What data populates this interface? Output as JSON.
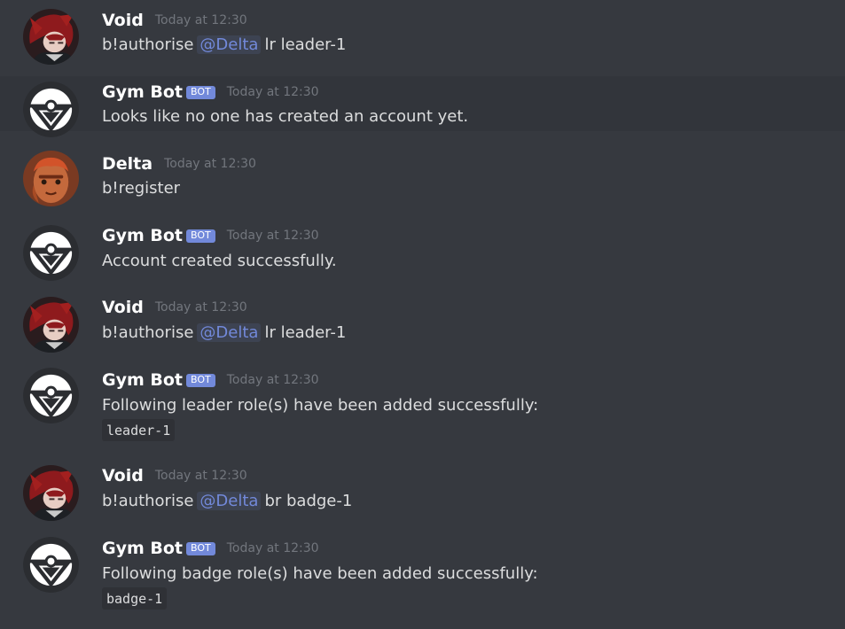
{
  "colors": {
    "background": "#36393f",
    "highlight_row": "#32353b",
    "username": "#ffffff",
    "message_text": "#dcddde",
    "timestamp": "#72767d",
    "mention": "#7289da",
    "bot_badge": "#7289da",
    "code_background": "#2f3136"
  },
  "messages": [
    {
      "author": "Void",
      "is_bot": false,
      "avatar": "void-avatar",
      "timestamp": "Today at 12:30",
      "text_before": "b!authorise",
      "mention": "@Delta",
      "text_after": "lr leader-1"
    },
    {
      "author": "Gym Bot",
      "is_bot": true,
      "badge": "BOT",
      "avatar": "gym-bot-avatar",
      "timestamp": "Today at 12:30",
      "text": "Looks like no one has created an account yet."
    },
    {
      "author": "Delta",
      "is_bot": false,
      "avatar": "delta-avatar",
      "timestamp": "Today at 12:30",
      "text": "b!register"
    },
    {
      "author": "Gym Bot",
      "is_bot": true,
      "badge": "BOT",
      "avatar": "gym-bot-avatar",
      "timestamp": "Today at 12:30",
      "text": "Account created successfully."
    },
    {
      "author": "Void",
      "is_bot": false,
      "avatar": "void-avatar",
      "timestamp": "Today at 12:30",
      "text_before": "b!authorise",
      "mention": "@Delta",
      "text_after": "lr leader-1"
    },
    {
      "author": "Gym Bot",
      "is_bot": true,
      "badge": "BOT",
      "avatar": "gym-bot-avatar",
      "timestamp": "Today at 12:30",
      "text": "Following leader role(s) have been added successfully:",
      "code": "leader-1"
    },
    {
      "author": "Void",
      "is_bot": false,
      "avatar": "void-avatar",
      "timestamp": "Today at 12:30",
      "text_before": "b!authorise",
      "mention": "@Delta",
      "text_after": "br badge-1"
    },
    {
      "author": "Gym Bot",
      "is_bot": true,
      "badge": "BOT",
      "avatar": "gym-bot-avatar",
      "timestamp": "Today at 12:30",
      "text": "Following badge role(s) have been added successfully:",
      "code": "badge-1"
    }
  ]
}
